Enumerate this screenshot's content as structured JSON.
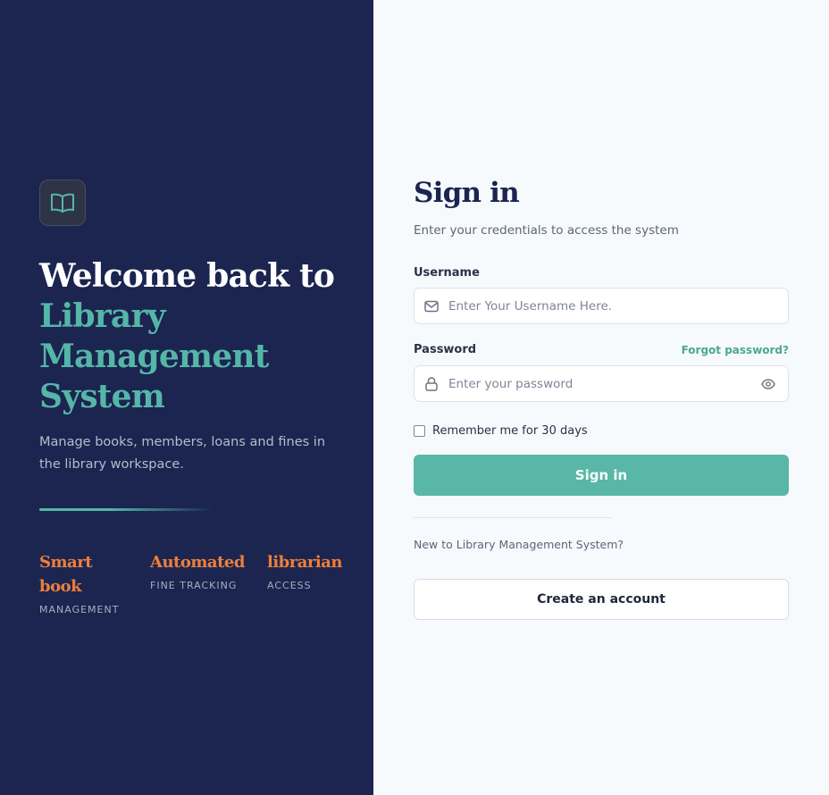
{
  "brand": {
    "logo_icon": "book-open-icon",
    "accent": "#55b6a8",
    "panel_bg": "#1b2550",
    "highlight": "#ee7f3a"
  },
  "hero": {
    "headline_line1": "Welcome back to",
    "headline_line2": "Library",
    "headline_line3": "Management",
    "headline_line4": "System",
    "tagline": "Manage books, members, loans and fines in the library workspace."
  },
  "features": [
    {
      "title_line1": "Smart",
      "title_line2": "book",
      "subtitle": "MANAGEMENT"
    },
    {
      "title_line1": "Automated",
      "title_line2": "",
      "subtitle": "FINE TRACKING"
    },
    {
      "title_line1": "librarian",
      "title_line2": "",
      "subtitle": "ACCESS"
    }
  ],
  "form": {
    "title": "Sign in",
    "subtitle": "Enter your credentials to access the system",
    "username_label": "Username",
    "username_placeholder": "Enter Your Username Here.",
    "username_value": "",
    "password_label": "Password",
    "password_placeholder": "Enter your password",
    "password_value": "",
    "forgot_label": "Forgot password?",
    "remember_label": "Remember me for 30 days",
    "remember_checked": false,
    "submit_label": "Sign in",
    "new_user_text": "New to Library Management System?",
    "create_account_label": "Create an account"
  }
}
